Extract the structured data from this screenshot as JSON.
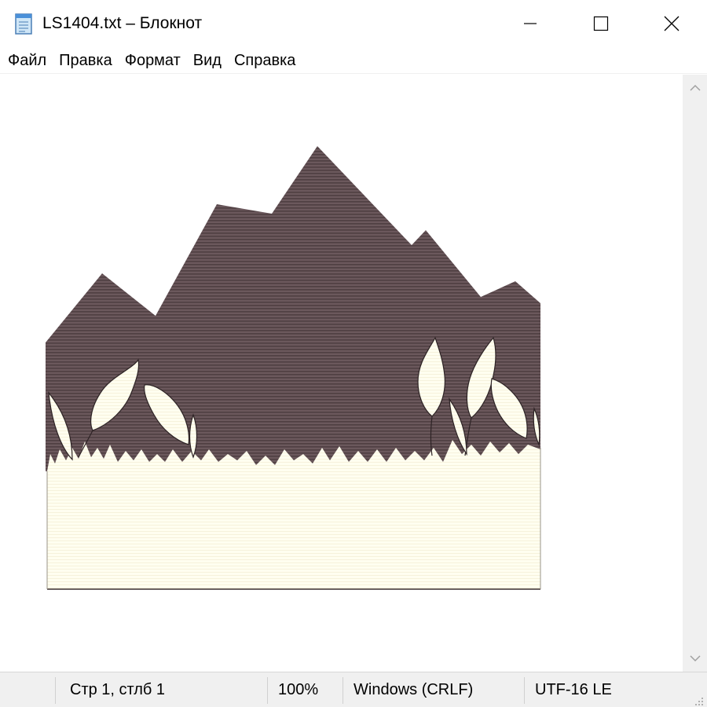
{
  "window": {
    "title": "LS1404.txt – Блокнот",
    "icon": "notepad-icon",
    "controls": [
      "minimize-icon",
      "maximize-icon",
      "close-icon"
    ]
  },
  "menu": {
    "items": [
      {
        "label": "Файл"
      },
      {
        "label": "Правка"
      },
      {
        "label": "Формат"
      },
      {
        "label": "Вид"
      },
      {
        "label": "Справка"
      }
    ]
  },
  "document": {
    "content_description_icon": "ascii-art-mountains-wheat",
    "colors": {
      "sky": "#695559",
      "grass": "#fffdeb",
      "line": "#3a2e30"
    }
  },
  "status": {
    "position": "Стр 1, стлб 1",
    "zoom": "100%",
    "line_endings": "Windows (CRLF)",
    "encoding": "UTF-16 LE"
  }
}
